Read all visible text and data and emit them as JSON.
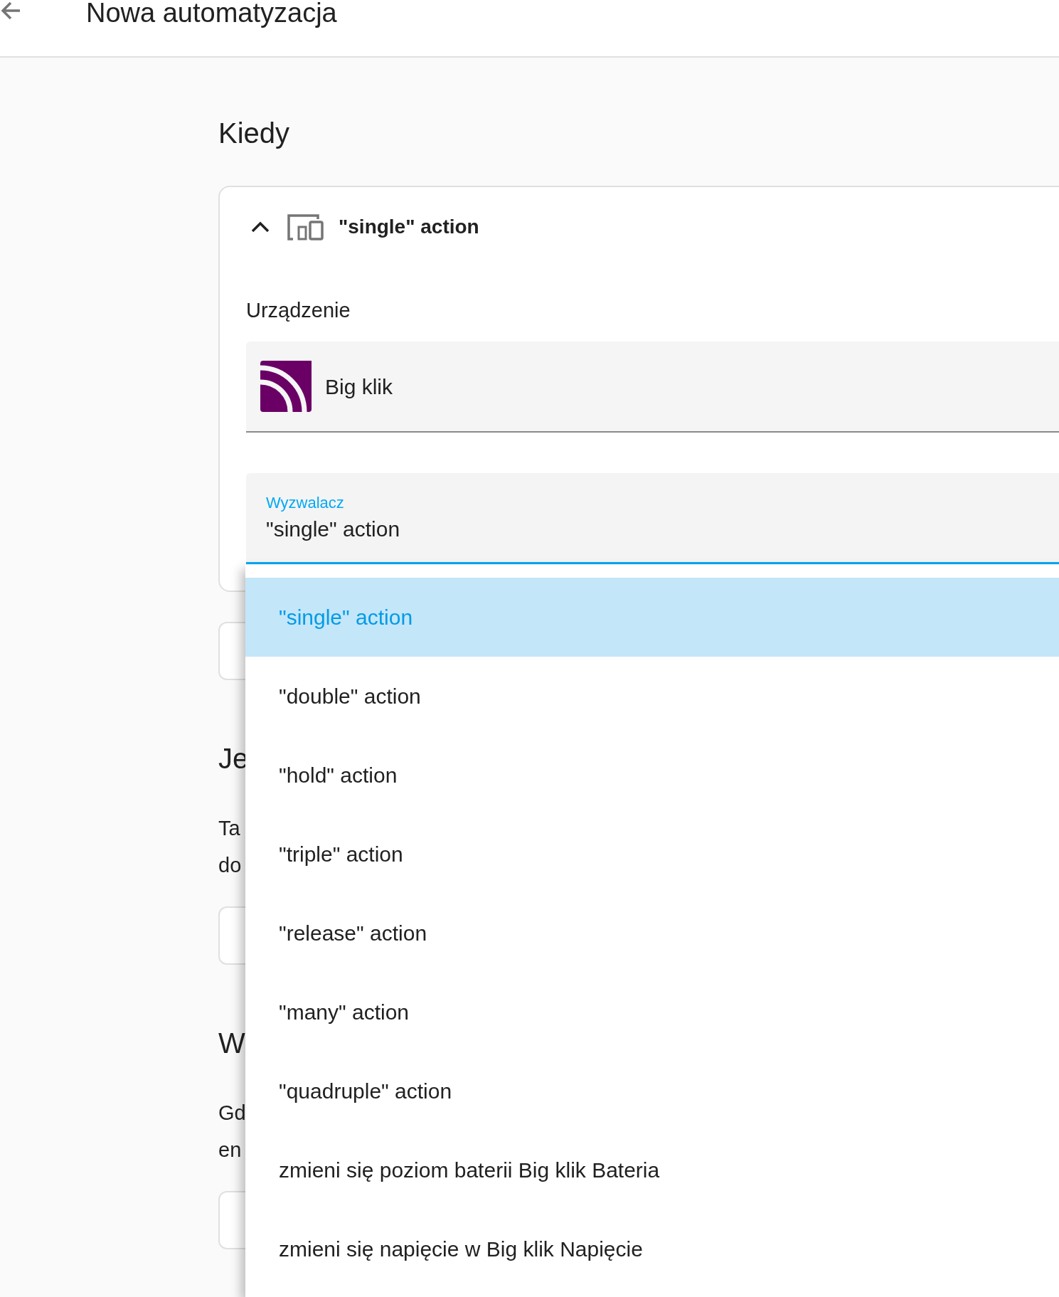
{
  "app_bar": {
    "title": "Nowa automatyzacja"
  },
  "when": {
    "heading": "Kiedy",
    "trigger_card": {
      "expanded": true,
      "title": "\"single\" action",
      "device_label": "Urządzenie",
      "device": "Big klik",
      "trigger_field": {
        "label": "Wyzwalacz",
        "value": "\"single\" action",
        "focused": true
      }
    }
  },
  "and_if": {
    "heading": "Je",
    "description_lines": [
      "Ta",
      "do"
    ]
  },
  "then": {
    "heading": "W",
    "description_lines": [
      "Gd",
      "en"
    ]
  },
  "dropdown": {
    "options": [
      {
        "label": "\"single\" action",
        "selected": true
      },
      {
        "label": "\"double\" action",
        "selected": false
      },
      {
        "label": "\"hold\" action",
        "selected": false
      },
      {
        "label": "\"triple\" action",
        "selected": false
      },
      {
        "label": "\"release\" action",
        "selected": false
      },
      {
        "label": "\"many\" action",
        "selected": false
      },
      {
        "label": "\"quadruple\" action",
        "selected": false
      },
      {
        "label": "zmieni się poziom baterii Big klik Bateria",
        "selected": false
      },
      {
        "label": "zmieni się napięcie w Big klik Napięcie",
        "selected": false
      }
    ]
  }
}
